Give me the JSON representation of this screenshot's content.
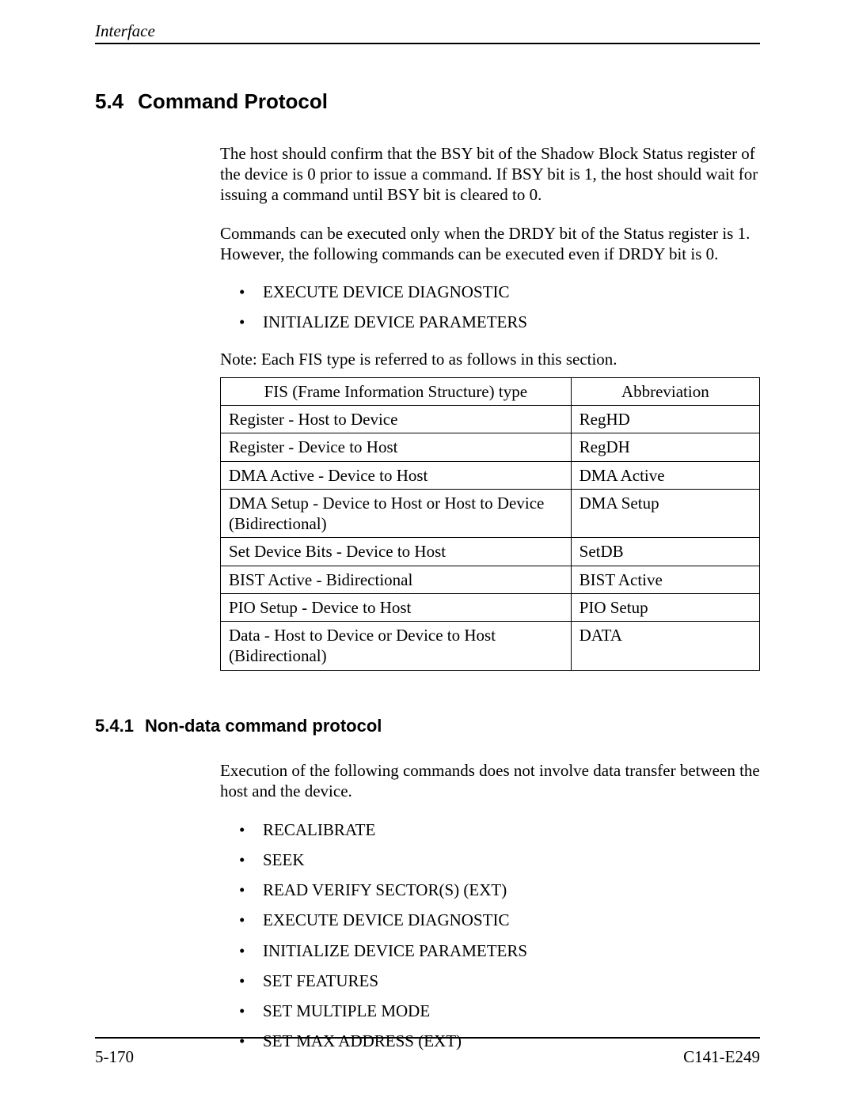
{
  "header": {
    "running": "Interface"
  },
  "section": {
    "number": "5.4",
    "title": "Command Protocol",
    "p1": "The host should confirm that the BSY bit of the Shadow Block Status register of the device is 0 prior to issue a command. If BSY bit is 1, the host should wait for issuing a command until BSY bit is cleared to 0.",
    "p2": "Commands can be executed only when the DRDY bit of the Status register is 1. However, the following commands can be executed even if DRDY bit is 0.",
    "exceptions": [
      "EXECUTE DEVICE DIAGNOSTIC",
      "INITIALIZE DEVICE PARAMETERS"
    ],
    "note": "Note:  Each FIS type is referred to as follows in this section."
  },
  "fis_table": {
    "head": [
      "FIS (Frame Information Structure) type",
      "Abbreviation"
    ],
    "rows": [
      [
        "Register - Host to Device",
        "RegHD"
      ],
      [
        "Register - Device to Host",
        "RegDH"
      ],
      [
        "DMA Active - Device to Host",
        "DMA Active"
      ],
      [
        "DMA Setup - Device to Host or Host to Device (Bidirectional)",
        "DMA Setup"
      ],
      [
        "Set Device Bits - Device to Host",
        "SetDB"
      ],
      [
        "BIST Active - Bidirectional",
        "BIST Active"
      ],
      [
        "PIO Setup - Device to Host",
        "PIO Setup"
      ],
      [
        "Data - Host to Device or Device to Host (Bidirectional)",
        "DATA"
      ]
    ]
  },
  "subsection": {
    "number": "5.4.1",
    "title": "Non-data command protocol",
    "p1": "Execution of the following commands does not involve data transfer between the host and the device.",
    "commands": [
      "RECALIBRATE",
      "SEEK",
      "READ VERIFY SECTOR(S) (EXT)",
      "EXECUTE DEVICE DIAGNOSTIC",
      "INITIALIZE DEVICE PARAMETERS",
      "SET FEATURES",
      "SET MULTIPLE MODE",
      "SET MAX ADDRESS (EXT)"
    ]
  },
  "footer": {
    "left": "5-170",
    "right": "C141-E249"
  }
}
